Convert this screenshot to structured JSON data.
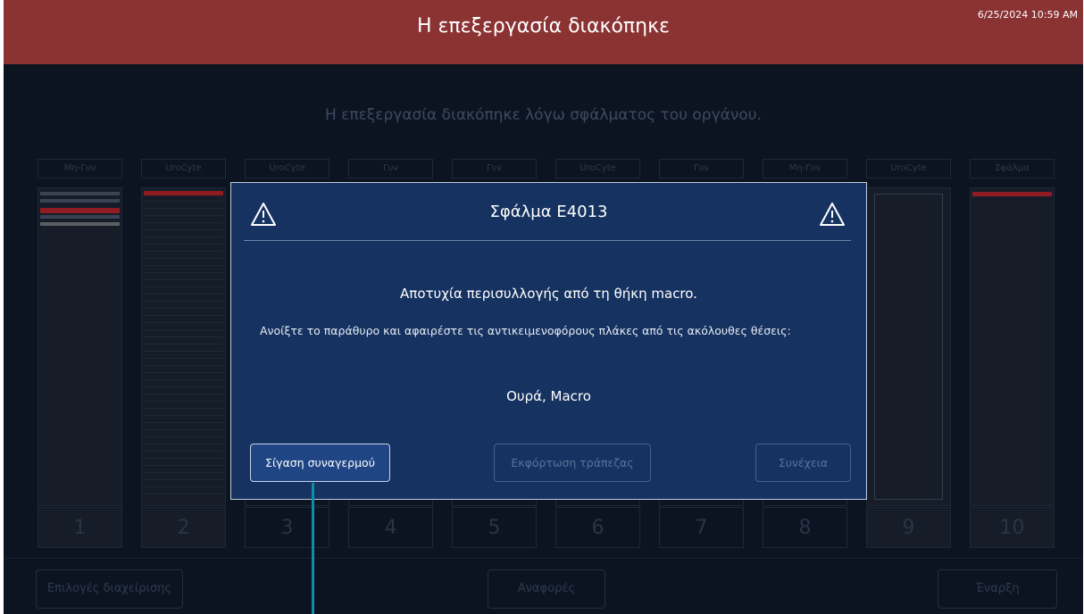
{
  "header": {
    "title": "Η επεξεργασία διακόπηκε",
    "timestamp": "6/25/2024 10:59 AM"
  },
  "subtitle": "Η επεξεργασία διακόπηκε λόγω σφάλματος του οργάνου.",
  "columns": [
    {
      "label": "Μη-Γυν",
      "number": "1"
    },
    {
      "label": "UroCyte",
      "number": "2"
    },
    {
      "label": "UroCyte",
      "number": "3"
    },
    {
      "label": "Γυν",
      "number": "4"
    },
    {
      "label": "Γυν",
      "number": "5"
    },
    {
      "label": "UroCyte",
      "number": "6"
    },
    {
      "label": "Γυν",
      "number": "7"
    },
    {
      "label": "Μη-Γυν",
      "number": "8"
    },
    {
      "label": "UroCyte",
      "number": "9"
    },
    {
      "label": "Σφάλμα",
      "number": "10"
    }
  ],
  "dialog": {
    "title": "Σφάλμα E4013",
    "message": "Αποτυχία περισυλλογής από τη θήκη macro.",
    "instruction": "Ανοίξτε το παράθυρο και αφαιρέστε τις αντικειμενοφόρους πλάκες από τις ακόλουθες θέσεις:",
    "locations": "Ουρά, Macro",
    "buttons": {
      "silence": "Σίγαση συναγερμού",
      "unload": "Εκφόρτωση τράπεζας",
      "continue": "Συνέχεια"
    },
    "icon": "warning-triangle-icon"
  },
  "bottom": {
    "admin": "Επιλογές διαχείρισης",
    "reports": "Αναφορές",
    "start": "Έναρξη"
  },
  "colors": {
    "header_bg": "#8b3233",
    "dialog_bg": "#163260",
    "error_red": "#8f1c22",
    "pointer": "#0d8fa8"
  }
}
